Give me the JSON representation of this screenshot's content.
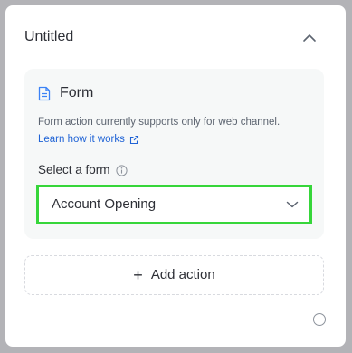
{
  "section": {
    "title": "Untitled"
  },
  "form_card": {
    "title": "Form",
    "description": "Form action currently supports only for web channel.",
    "learn_link": "Learn how it works",
    "select_label": "Select a form",
    "selected_value": "Account Opening"
  },
  "add_action": {
    "label": "Add action"
  },
  "icons": {
    "collapse": "chevron-up-icon",
    "form": "document-icon",
    "external_link": "external-link-icon",
    "info": "info-icon",
    "dropdown": "chevron-down-icon",
    "add": "plus-icon"
  },
  "colors": {
    "panel_background": "#ffffff",
    "card_background": "#f6f8f8",
    "link": "#1f63d6",
    "highlight_border": "#36d63a",
    "text": "#2d2f36",
    "muted_text": "#5c6470"
  }
}
